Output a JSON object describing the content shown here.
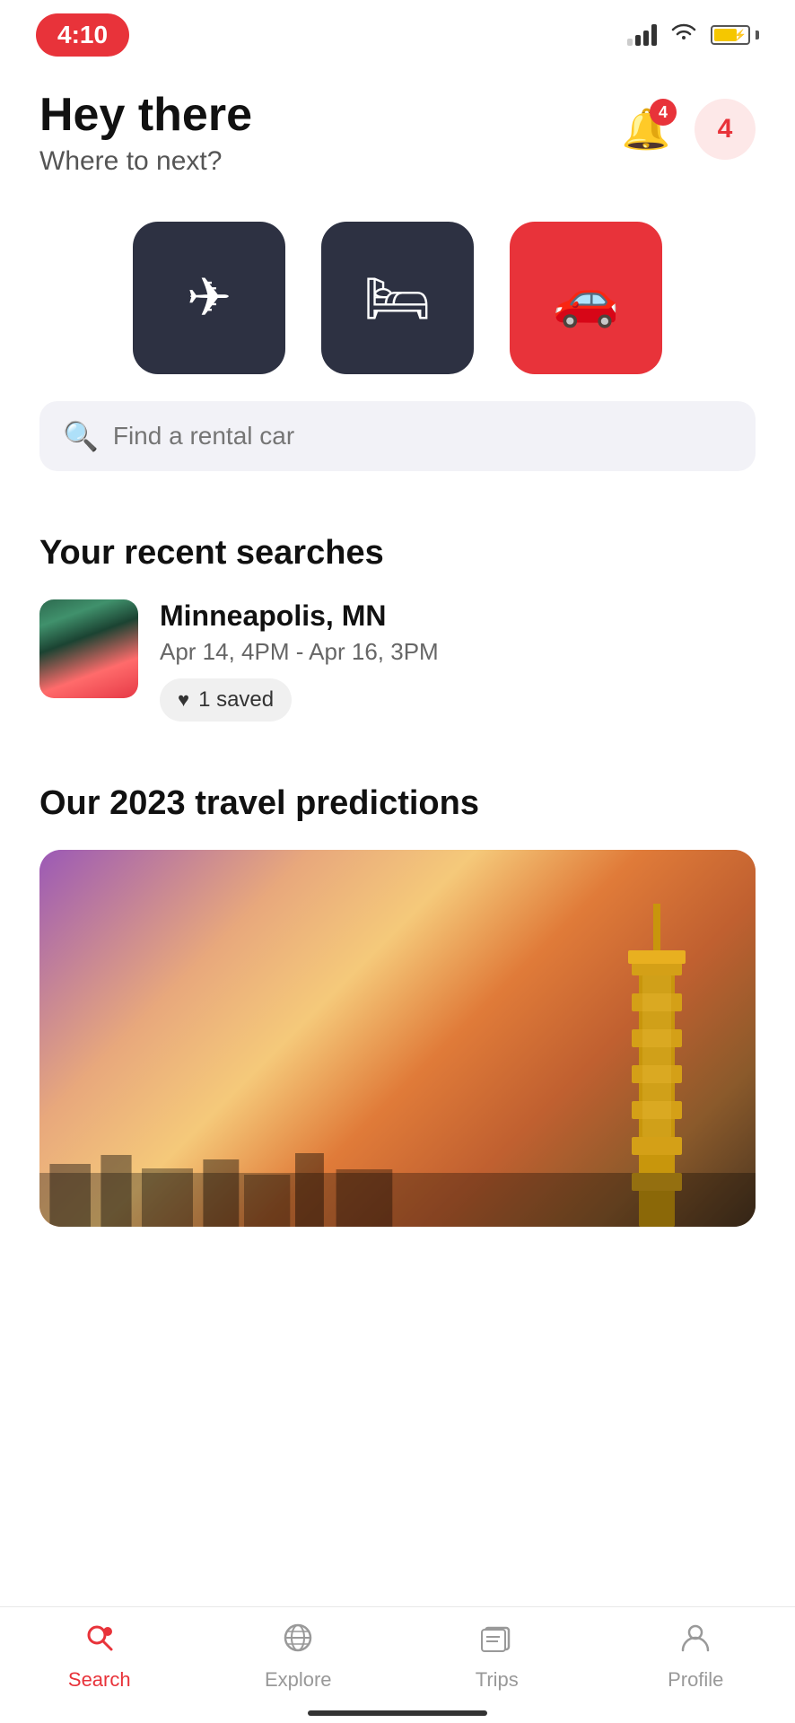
{
  "statusBar": {
    "time": "4:10",
    "signal": [
      1,
      2,
      3,
      4
    ],
    "wifi": "wifi",
    "battery": 70
  },
  "header": {
    "greeting": "Hey there",
    "subtitle": "Where to next?",
    "notifCount": "4",
    "userBadge": "4"
  },
  "categories": [
    {
      "id": "flights",
      "icon": "✈",
      "label": "Flights",
      "active": false
    },
    {
      "id": "hotels",
      "icon": "🛏",
      "label": "Hotels",
      "active": false
    },
    {
      "id": "cars",
      "icon": "🚗",
      "label": "Cars",
      "active": true
    }
  ],
  "searchBar": {
    "placeholder": "Find a rental car"
  },
  "recentSearches": {
    "title": "Your recent searches",
    "items": [
      {
        "city": "Minneapolis, MN",
        "dates": "Apr 14, 4PM - Apr 16, 3PM",
        "saved": "1 saved"
      }
    ]
  },
  "predictions": {
    "title": "Our 2023 travel predictions"
  },
  "bottomNav": [
    {
      "id": "search",
      "icon": "search",
      "label": "Search",
      "active": true
    },
    {
      "id": "explore",
      "icon": "explore",
      "label": "Explore",
      "active": false
    },
    {
      "id": "trips",
      "icon": "trips",
      "label": "Trips",
      "active": false
    },
    {
      "id": "profile",
      "icon": "profile",
      "label": "Profile",
      "active": false
    }
  ]
}
